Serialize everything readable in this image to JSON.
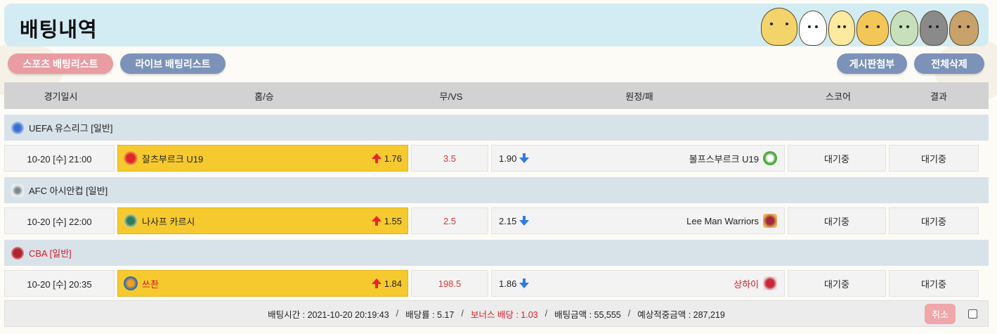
{
  "page": {
    "title": "배팅내역"
  },
  "nav": {
    "sports_list": "스포츠 배팅리스트",
    "live_list": "라이브 배팅리스트",
    "post_to_board": "게시판첨부",
    "delete_all": "전체삭제"
  },
  "table": {
    "headers": [
      "경기일시",
      "홈/승",
      "무/VS",
      "원정/패",
      "스코어",
      "결과"
    ]
  },
  "leagues": [
    {
      "name": "UEFA 유스리그 [일반]",
      "icon": "uefa-youth-icon",
      "game": {
        "datetime": "10-20 [수] 21:00",
        "home_team": "잘츠부르크 U19",
        "home_odds": "1.76",
        "draw": "3.5",
        "away_odds": "1.90",
        "away_team": "볼프스부르크 U19",
        "score": "대기중",
        "result": "대기중"
      }
    },
    {
      "name": "AFC 아시안컵 [일반]",
      "icon": "afc-cup-icon",
      "game": {
        "datetime": "10-20 [수] 22:00",
        "home_team": "나사프 카르시",
        "home_odds": "1.55",
        "draw": "2.5",
        "away_odds": "2.15",
        "away_team": "Lee Man Warriors",
        "score": "대기중",
        "result": "대기중"
      }
    },
    {
      "name": "CBA [일반]",
      "icon": "basketball-icon",
      "game": {
        "datetime": "10-20 [수] 20:35",
        "home_team": "쓰촨",
        "home_odds": "1.84",
        "draw": "198.5",
        "away_odds": "1.86",
        "away_team": "상하이",
        "score": "대기중",
        "result": "대기중"
      }
    }
  ],
  "summary": {
    "bet_time": "배팅시간 : 2021-10-20 20:19:43",
    "odds": "배당률 : 5.17",
    "bonus": "보너스 배당 : 1.03",
    "amount": "배팅금액 : 55,555",
    "expected": "예상적중금액 : 287,219",
    "cancel": "취소",
    "separator": "/"
  },
  "colors": {
    "title_bg": "#d3ecf3",
    "home_highlight": "#f6ca2f",
    "league_bg": "#d8e2e9",
    "header_bg": "#d2d2d2",
    "pill_pink": "#e99ca1",
    "pill_blue": "#7c92b8",
    "odds_up": "#e8242a",
    "odds_down": "#2f7be0",
    "alert_red": "#d21d2a"
  }
}
